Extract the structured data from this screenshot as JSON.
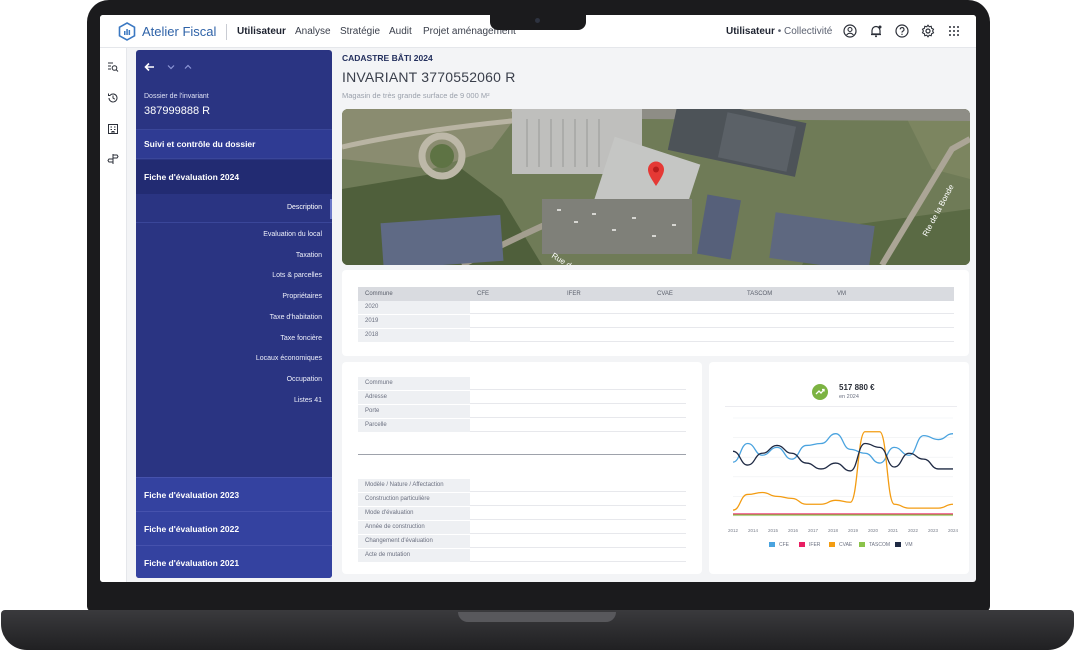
{
  "app": {
    "brand": "Atelier Fiscal"
  },
  "nav": {
    "items": [
      "Utilisateur",
      "Analyse",
      "Stratégie",
      "Audit",
      "Projet aménagement"
    ],
    "active": "Utilisateur"
  },
  "user": {
    "name": "Utilisateur",
    "separator": "•",
    "org": "Collectivité"
  },
  "topbar_icons": [
    "user-circle-icon",
    "bell-icon",
    "help-icon",
    "settings-icon",
    "apps-grid-icon"
  ],
  "rail_icons": [
    "search-list-icon",
    "history-icon",
    "building-icon",
    "signpost-icon"
  ],
  "sidebar": {
    "dossier_label": "Dossier de l'invariant",
    "dossier_number": "387999888 R",
    "suivi": "Suivi et contrôle du dossier",
    "fiche_active": "Fiche d'évaluation 2024",
    "description": "Description",
    "items": [
      "Evaluation du local",
      "Taxation",
      "Lots & parcelles",
      "Propriétaires",
      "Taxe d'habitation",
      "Taxe foncière",
      "Locaux économiques",
      "Occupation",
      "Listes 41"
    ],
    "other_fiches": [
      "Fiche d'évaluation 2023",
      "Fiche d'évaluation 2022",
      "Fiche d'évaluation 2021"
    ]
  },
  "main": {
    "kicker": "CADASTRE BÂTI 2024",
    "title": "INVARIANT 3770552060 R",
    "subtitle": "Magasin de très grande surface de 9 000 M²",
    "map": {
      "road_labels": [
        "Rue de l",
        "Rte de la Bonde"
      ]
    },
    "tax_table": {
      "headers": [
        "Commune",
        "CFE",
        "IFER",
        "CVAE",
        "TASCOM",
        "VM"
      ],
      "rows": [
        "2020",
        "2019",
        "2018"
      ]
    },
    "info_fields_top": [
      "Commune",
      "Adresse",
      "Porte",
      "Parcelle"
    ],
    "info_fields_bottom": [
      "Modèle / Nature / Affectaction",
      "Construction particulière",
      "Mode d'évaluation",
      "Année de construction",
      "Changement d'évaluation",
      "Acte de mutation"
    ],
    "kpi": {
      "value": "517 880 €",
      "subtitle": "en 2024"
    }
  },
  "chart_data": {
    "type": "line",
    "categories": [
      "2012",
      "2014",
      "2015",
      "2016",
      "2017",
      "2018",
      "2019",
      "2020",
      "2021",
      "2022",
      "2023",
      "2024"
    ],
    "ylim": [
      0,
      100
    ],
    "grid": true,
    "legend_position": "bottom",
    "series": [
      {
        "name": "CFE",
        "color": "#4aa3df",
        "values": [
          55,
          74,
          62,
          70,
          58,
          72,
          74,
          84,
          68,
          64,
          54,
          70,
          62,
          82,
          78,
          84
        ]
      },
      {
        "name": "IFER",
        "color": "#e91e63",
        "values": [
          2,
          2,
          2,
          2,
          2,
          2,
          2,
          2,
          2,
          2,
          2,
          2,
          2,
          2,
          2,
          2
        ]
      },
      {
        "name": "CVAE",
        "color": "#f39c12",
        "values": [
          6,
          22,
          24,
          20,
          18,
          12,
          12,
          16,
          14,
          86,
          86,
          12,
          8,
          8,
          8,
          12
        ]
      },
      {
        "name": "TASCOM",
        "color": "#8bc34a",
        "values": [
          1,
          1,
          1,
          1,
          1,
          1,
          1,
          1,
          1,
          1,
          1,
          1,
          1,
          1,
          1,
          1
        ]
      },
      {
        "name": "VM",
        "color": "#1f2a44",
        "values": [
          66,
          52,
          64,
          72,
          64,
          54,
          48,
          54,
          46,
          74,
          70,
          50,
          64,
          58,
          48,
          48
        ]
      }
    ]
  }
}
